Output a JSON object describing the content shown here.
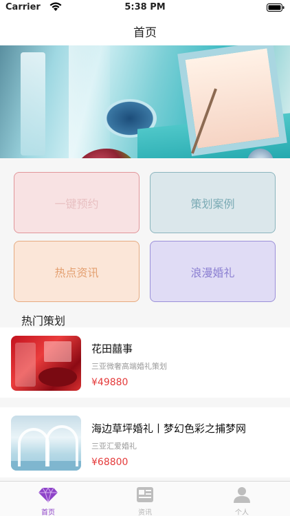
{
  "status_bar": {
    "carrier": "Carrier",
    "time": "5:38 PM",
    "icons": [
      "wifi-icon",
      "battery-icon"
    ]
  },
  "nav": {
    "title": "首页"
  },
  "quick_actions": [
    {
      "label": "一键预约",
      "color": "#f8e2e3"
    },
    {
      "label": "策划案例",
      "color": "#dbe7eb"
    },
    {
      "label": "热点资讯",
      "color": "#fbe6d8"
    },
    {
      "label": "浪漫婚礼",
      "color": "#e0dcf5"
    }
  ],
  "section": {
    "title": "热门策划"
  },
  "cards": [
    {
      "name": "花田囍事",
      "desc": "三亚微奢高端婚礼策划",
      "price": "¥49880"
    },
    {
      "name": "海边草坪婚礼丨梦幻色彩之捕梦网",
      "desc": "三亚汇爱婚礼",
      "price": "¥68800"
    }
  ],
  "tabs": [
    {
      "label": "首页",
      "icon": "diamond-icon",
      "active": true,
      "color": "#8e44c8"
    },
    {
      "label": "资讯",
      "icon": "news-icon",
      "active": false,
      "color": "#b3b3b3"
    },
    {
      "label": "个人",
      "icon": "person-icon",
      "active": false,
      "color": "#b3b3b3"
    }
  ]
}
